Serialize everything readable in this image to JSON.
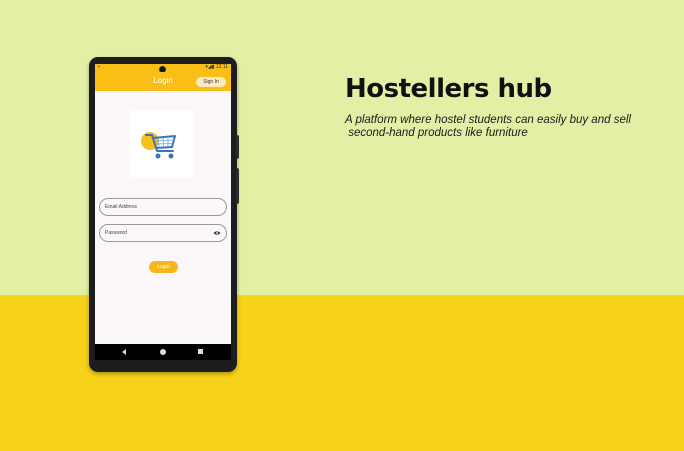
{
  "hero": {
    "title": "Hostellers hub",
    "subtitle_line1": "A platform where hostel students can easily buy and sell",
    "subtitle_line2": " second-hand products like furniture"
  },
  "phone": {
    "status": {
      "left": "▪",
      "right": "▾◢▮ 12:11"
    },
    "app_bar": {
      "title": "Login",
      "sign_in_label": "Sign In"
    },
    "form": {
      "email_placeholder": "Email Address",
      "password_placeholder": "Password",
      "login_label": "Login"
    },
    "nav": {
      "back": "back-icon",
      "home": "home-icon",
      "recent": "recent-apps-icon"
    }
  },
  "colors": {
    "top_background": "#e3efa5",
    "bottom_background": "#f6d21a",
    "accent": "#f9bf14",
    "cart_blue": "#3a74b8"
  }
}
